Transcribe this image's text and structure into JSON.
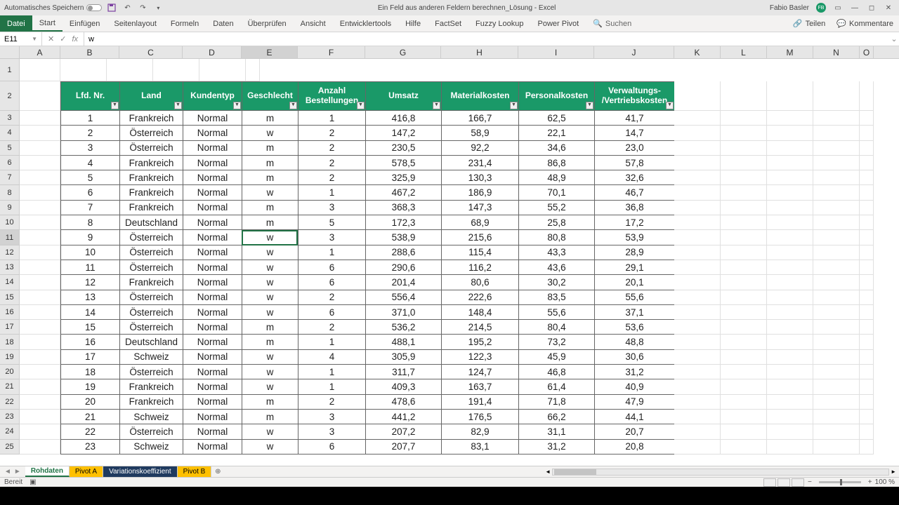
{
  "titlebar": {
    "autosave_label": "Automatisches Speichern",
    "doc_title": "Ein Feld aus anderen Feldern berechnen_Lösung  -  Excel",
    "user_name": "Fabio Basler",
    "user_initials": "FB"
  },
  "ribbon": {
    "file": "Datei",
    "tabs": [
      "Start",
      "Einfügen",
      "Seitenlayout",
      "Formeln",
      "Daten",
      "Überprüfen",
      "Ansicht",
      "Entwicklertools",
      "Hilfe",
      "FactSet",
      "Fuzzy Lookup",
      "Power Pivot"
    ],
    "search": "Suchen",
    "share": "Teilen",
    "comments": "Kommentare"
  },
  "formula_bar": {
    "name_box": "E11",
    "formula": "w"
  },
  "columns": [
    "A",
    "B",
    "C",
    "D",
    "E",
    "F",
    "G",
    "H",
    "I",
    "J",
    "K",
    "L",
    "M",
    "N",
    "O"
  ],
  "row_numbers": [
    "1",
    "2",
    "3",
    "4",
    "5",
    "6",
    "7",
    "8",
    "9",
    "10",
    "11",
    "12",
    "13",
    "14",
    "15",
    "16",
    "17",
    "18",
    "19",
    "20",
    "21",
    "22",
    "23",
    "24",
    "25"
  ],
  "selected": {
    "col_index": 4,
    "row_index": 10,
    "row_h_sel": "11"
  },
  "table": {
    "headers": [
      "Lfd. Nr.",
      "Land",
      "Kundentyp",
      "Geschlecht",
      "Anzahl Bestellungen",
      "Umsatz",
      "Materialkosten",
      "Personalkosten",
      "Verwaltungs-/Vertriebskosten"
    ],
    "rows": [
      [
        "1",
        "Frankreich",
        "Normal",
        "m",
        "1",
        "416,8",
        "166,7",
        "62,5",
        "41,7"
      ],
      [
        "2",
        "Österreich",
        "Normal",
        "w",
        "2",
        "147,2",
        "58,9",
        "22,1",
        "14,7"
      ],
      [
        "3",
        "Österreich",
        "Normal",
        "m",
        "2",
        "230,5",
        "92,2",
        "34,6",
        "23,0"
      ],
      [
        "4",
        "Frankreich",
        "Normal",
        "m",
        "2",
        "578,5",
        "231,4",
        "86,8",
        "57,8"
      ],
      [
        "5",
        "Frankreich",
        "Normal",
        "m",
        "2",
        "325,9",
        "130,3",
        "48,9",
        "32,6"
      ],
      [
        "6",
        "Frankreich",
        "Normal",
        "w",
        "1",
        "467,2",
        "186,9",
        "70,1",
        "46,7"
      ],
      [
        "7",
        "Frankreich",
        "Normal",
        "m",
        "3",
        "368,3",
        "147,3",
        "55,2",
        "36,8"
      ],
      [
        "8",
        "Deutschland",
        "Normal",
        "m",
        "5",
        "172,3",
        "68,9",
        "25,8",
        "17,2"
      ],
      [
        "9",
        "Österreich",
        "Normal",
        "w",
        "3",
        "538,9",
        "215,6",
        "80,8",
        "53,9"
      ],
      [
        "10",
        "Österreich",
        "Normal",
        "w",
        "1",
        "288,6",
        "115,4",
        "43,3",
        "28,9"
      ],
      [
        "11",
        "Österreich",
        "Normal",
        "w",
        "6",
        "290,6",
        "116,2",
        "43,6",
        "29,1"
      ],
      [
        "12",
        "Frankreich",
        "Normal",
        "w",
        "6",
        "201,4",
        "80,6",
        "30,2",
        "20,1"
      ],
      [
        "13",
        "Österreich",
        "Normal",
        "w",
        "2",
        "556,4",
        "222,6",
        "83,5",
        "55,6"
      ],
      [
        "14",
        "Österreich",
        "Normal",
        "w",
        "6",
        "371,0",
        "148,4",
        "55,6",
        "37,1"
      ],
      [
        "15",
        "Österreich",
        "Normal",
        "m",
        "2",
        "536,2",
        "214,5",
        "80,4",
        "53,6"
      ],
      [
        "16",
        "Deutschland",
        "Normal",
        "m",
        "1",
        "488,1",
        "195,2",
        "73,2",
        "48,8"
      ],
      [
        "17",
        "Schweiz",
        "Normal",
        "w",
        "4",
        "305,9",
        "122,3",
        "45,9",
        "30,6"
      ],
      [
        "18",
        "Österreich",
        "Normal",
        "w",
        "1",
        "311,7",
        "124,7",
        "46,8",
        "31,2"
      ],
      [
        "19",
        "Frankreich",
        "Normal",
        "w",
        "1",
        "409,3",
        "163,7",
        "61,4",
        "40,9"
      ],
      [
        "20",
        "Frankreich",
        "Normal",
        "m",
        "2",
        "478,6",
        "191,4",
        "71,8",
        "47,9"
      ],
      [
        "21",
        "Schweiz",
        "Normal",
        "m",
        "3",
        "441,2",
        "176,5",
        "66,2",
        "44,1"
      ],
      [
        "22",
        "Österreich",
        "Normal",
        "w",
        "3",
        "207,2",
        "82,9",
        "31,1",
        "20,7"
      ],
      [
        "23",
        "Schweiz",
        "Normal",
        "w",
        "6",
        "207,7",
        "83,1",
        "31,2",
        "20,8"
      ]
    ]
  },
  "sheets": {
    "tabs": [
      {
        "name": "Rohdaten",
        "style": "active"
      },
      {
        "name": "Pivot A",
        "style": "yellow"
      },
      {
        "name": "Variationskoeffizient",
        "style": "dark"
      },
      {
        "name": "Pivot B",
        "style": "yellow"
      }
    ]
  },
  "status": {
    "ready": "Bereit",
    "zoom": "100 %"
  }
}
